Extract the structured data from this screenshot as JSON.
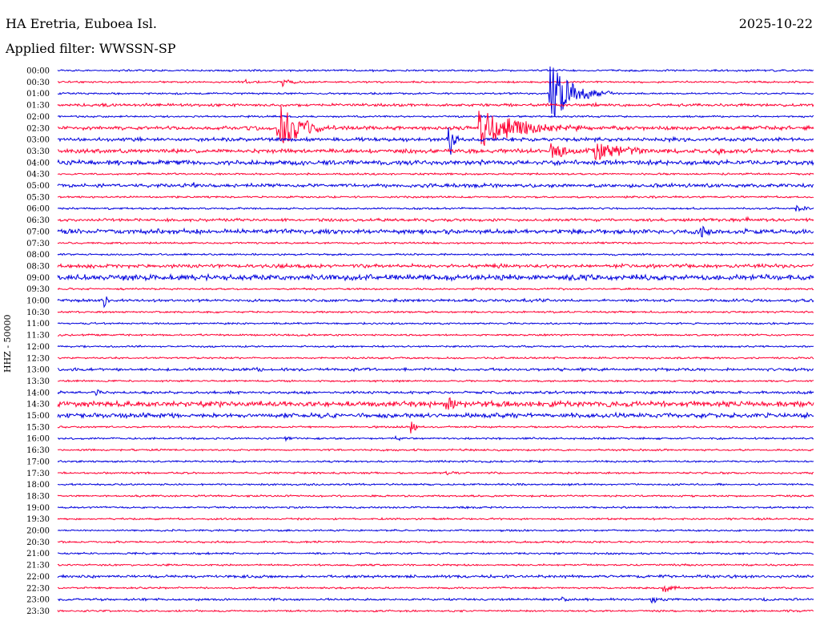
{
  "header": {
    "station": "HA Eretria, Euboea Isl.",
    "date": "2025-10-22",
    "filter": "Applied filter: WWSSN-SP"
  },
  "colors": {
    "even": "#0000dd",
    "odd": "#ff0033",
    "text": "#000000"
  },
  "chart_data": {
    "type": "line",
    "title": "HA Eretria, Euboea Isl.",
    "subtitle": "Applied filter: WWSSN-SP",
    "ylabel": "HHZ - 50000",
    "xlabel": "",
    "grid": false,
    "legend": "none",
    "rows": [
      "00:00",
      "00:30",
      "01:00",
      "01:30",
      "02:00",
      "02:30",
      "03:00",
      "03:30",
      "04:00",
      "04:30",
      "05:00",
      "05:30",
      "06:00",
      "06:30",
      "07:00",
      "07:30",
      "08:00",
      "08:30",
      "09:00",
      "09:30",
      "10:00",
      "10:30",
      "11:00",
      "11:30",
      "12:00",
      "12:30",
      "13:00",
      "13:30",
      "14:00",
      "14:30",
      "15:00",
      "15:30",
      "16:00",
      "16:30",
      "17:00",
      "17:30",
      "18:00",
      "18:30",
      "19:00",
      "19:30",
      "20:00",
      "20:30",
      "21:00",
      "21:30",
      "22:00",
      "22:30",
      "23:00",
      "23:30"
    ],
    "row_minutes": 30,
    "noise_levels": [
      1,
      1,
      1,
      1.5,
      1,
      2,
      2,
      2.2,
      2.5,
      1,
      2,
      1,
      1,
      1.5,
      2.5,
      1,
      1,
      2,
      3,
      1,
      1.5,
      1,
      1,
      1,
      1,
      1,
      1.5,
      1,
      1.5,
      3,
      2.5,
      1,
      1,
      1,
      1,
      1,
      1,
      1,
      1,
      1,
      1,
      1,
      1,
      1,
      1.5,
      1,
      1.2,
      1
    ],
    "events": [
      {
        "row": 1,
        "minute": 7.4,
        "amplitude": 3,
        "duration": 0.6
      },
      {
        "row": 1,
        "minute": 8.9,
        "amplitude": 6,
        "duration": 0.8
      },
      {
        "row": 2,
        "minute": 19.5,
        "amplitude": 40,
        "duration": 2.5
      },
      {
        "row": 3,
        "minute": 1.6,
        "amplitude": 3,
        "duration": 0.8
      },
      {
        "row": 3,
        "minute": 21.0,
        "amplitude": 2,
        "duration": 0.8
      },
      {
        "row": 5,
        "minute": 8.7,
        "amplitude": 35,
        "duration": 2.3
      },
      {
        "row": 5,
        "minute": 16.7,
        "amplitude": 28,
        "duration": 4.0
      },
      {
        "row": 6,
        "minute": 15.5,
        "amplitude": 32,
        "duration": 0.5
      },
      {
        "row": 7,
        "minute": 19.5,
        "amplitude": 8,
        "duration": 2.5
      },
      {
        "row": 7,
        "minute": 21.3,
        "amplitude": 10,
        "duration": 3.0
      },
      {
        "row": 7,
        "minute": 26.0,
        "amplitude": 3,
        "duration": 1.2
      },
      {
        "row": 8,
        "minute": 11.6,
        "amplitude": 2,
        "duration": 0.8
      },
      {
        "row": 10,
        "minute": 5.4,
        "amplitude": 4,
        "duration": 0.4
      },
      {
        "row": 12,
        "minute": 29.3,
        "amplitude": 4,
        "duration": 0.8
      },
      {
        "row": 13,
        "minute": 27.3,
        "amplitude": 4,
        "duration": 0.4
      },
      {
        "row": 14,
        "minute": 25.5,
        "amplitude": 12,
        "duration": 0.6
      },
      {
        "row": 20,
        "minute": 1.8,
        "amplitude": 16,
        "duration": 0.3
      },
      {
        "row": 20,
        "minute": 18.5,
        "amplitude": 2,
        "duration": 1.2
      },
      {
        "row": 26,
        "minute": 7.9,
        "amplitude": 3,
        "duration": 0.5
      },
      {
        "row": 28,
        "minute": 1.5,
        "amplitude": 3,
        "duration": 0.5
      },
      {
        "row": 29,
        "minute": 15.4,
        "amplitude": 10,
        "duration": 0.9
      },
      {
        "row": 31,
        "minute": 14.0,
        "amplitude": 9,
        "duration": 0.6
      },
      {
        "row": 32,
        "minute": 9.0,
        "amplitude": 3,
        "duration": 0.6
      },
      {
        "row": 32,
        "minute": 13.4,
        "amplitude": 4,
        "duration": 0.4
      },
      {
        "row": 35,
        "minute": 15.4,
        "amplitude": 2,
        "duration": 1.0
      },
      {
        "row": 45,
        "minute": 24.0,
        "amplitude": 9,
        "duration": 0.7
      },
      {
        "row": 46,
        "minute": 20.0,
        "amplitude": 3,
        "duration": 0.8
      },
      {
        "row": 46,
        "minute": 23.5,
        "amplitude": 4,
        "duration": 1.6
      },
      {
        "row": 46,
        "minute": 28.0,
        "amplitude": 3,
        "duration": 0.4
      }
    ]
  }
}
